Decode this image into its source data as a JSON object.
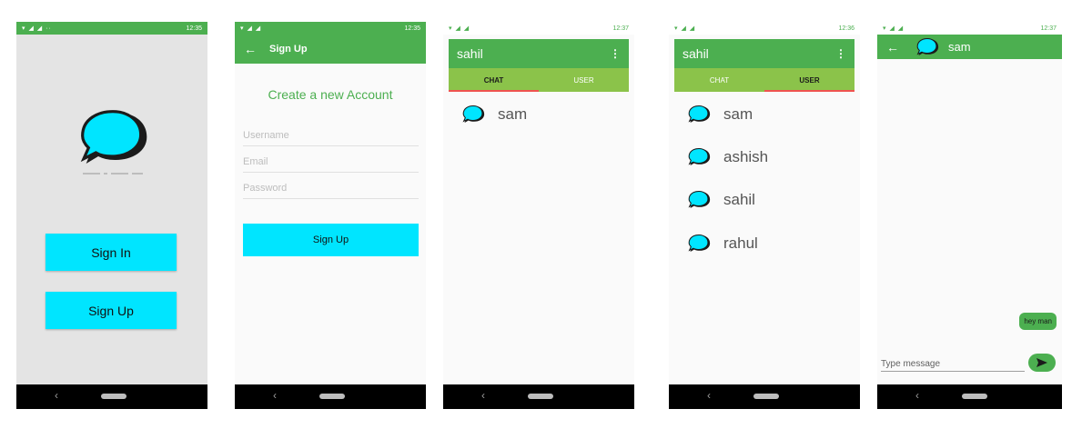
{
  "screen1": {
    "status_time": "12:35",
    "sign_in_label": "Sign In",
    "sign_up_label": "Sign Up"
  },
  "screen2": {
    "status_time": "12:35",
    "appbar_title": "Sign Up",
    "heading": "Create a new Account",
    "username_placeholder": "Username",
    "email_placeholder": "Email",
    "password_placeholder": "Password",
    "sign_up_button": "Sign Up"
  },
  "screen3": {
    "status_time": "12:37",
    "title": "sahil",
    "tabs": [
      {
        "label": "CHAT",
        "active": true
      },
      {
        "label": "USER",
        "active": false
      }
    ],
    "chats": [
      {
        "name": "sam"
      }
    ]
  },
  "screen4": {
    "status_time": "12:36",
    "title": "sahil",
    "tabs": [
      {
        "label": "CHAT",
        "active": false
      },
      {
        "label": "USER",
        "active": true
      }
    ],
    "users": [
      {
        "name": "sam"
      },
      {
        "name": "ashish"
      },
      {
        "name": "sahil"
      },
      {
        "name": "rahul"
      }
    ]
  },
  "screen5": {
    "status_time": "12:37",
    "contact_name": "sam",
    "messages": [
      {
        "text": "hey man",
        "outgoing": true
      }
    ],
    "input_placeholder": "Type message"
  },
  "icons": [
    "back-arrow-icon",
    "menu-icon",
    "chat-bubble-icon",
    "send-icon",
    "nav-back-icon",
    "nav-home-icon"
  ],
  "colors": {
    "primary": "#4caf50",
    "tab_bar": "#8bc34a",
    "accent_cyan": "#00e5ff",
    "tab_indicator": "#ef5350"
  }
}
